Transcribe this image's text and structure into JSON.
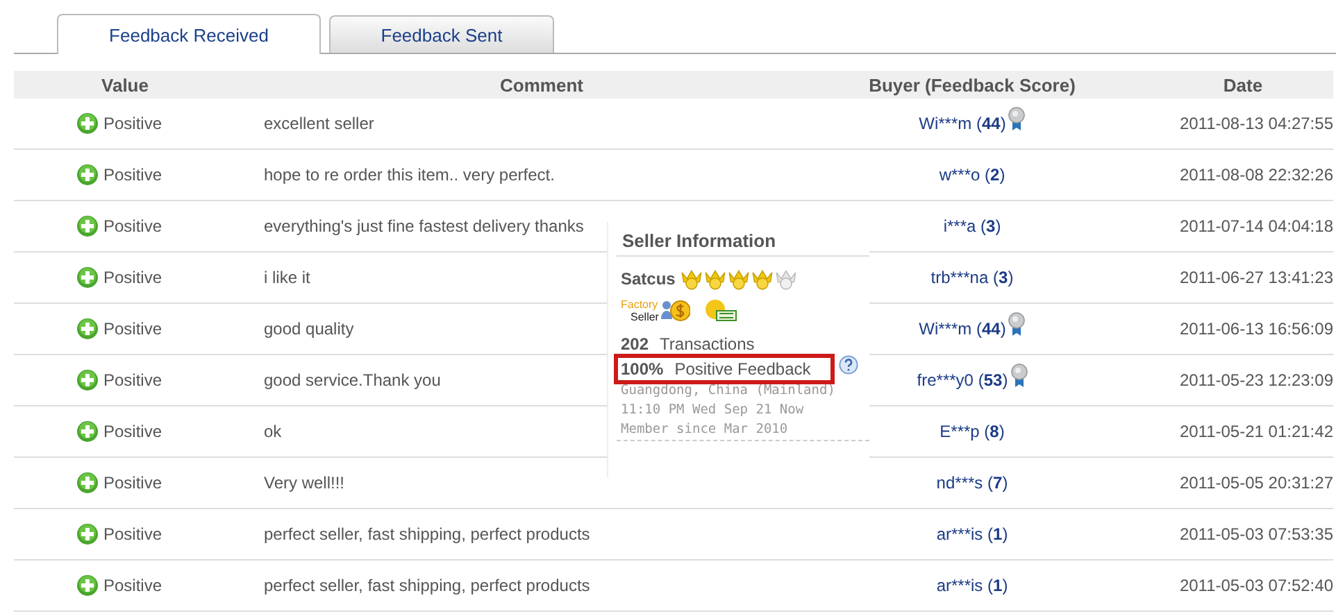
{
  "tabs": [
    {
      "label": "Feedback Received",
      "selected": true
    },
    {
      "label": "Feedback Sent",
      "selected": false
    }
  ],
  "table": {
    "columns": [
      "Value",
      "Comment",
      "Buyer (Feedback Score)",
      "Date"
    ],
    "rows": [
      {
        "value": "Positive",
        "comment": "excellent seller",
        "buyer": "Wi***m",
        "score": "(**44**)",
        "medal": true,
        "date": "2011-08-13 04:27:55"
      },
      {
        "value": "Positive",
        "comment": "hope to re order this item.. very perfect.",
        "buyer": "w***o",
        "score": "(**2**)",
        "medal": false,
        "date": "2011-08-08 22:32:26"
      },
      {
        "value": "Positive",
        "comment": "everything's just fine fastest delivery thanks",
        "buyer": "i***a",
        "score": "(**3**)",
        "medal": false,
        "date": "2011-07-14 04:04:18"
      },
      {
        "value": "Positive",
        "comment": "i like it",
        "buyer": "trb***na",
        "score": "(**3**)",
        "medal": false,
        "date": "2011-06-27 13:41:23"
      },
      {
        "value": "Positive",
        "comment": "good quality",
        "buyer": "Wi***m",
        "score": "(**44**)",
        "medal": true,
        "date": "2011-06-13 16:56:09"
      },
      {
        "value": "Positive",
        "comment": "good service.Thank you",
        "buyer": "fre***y0",
        "score": "(**53**)",
        "medal": true,
        "date": "2011-05-23 12:23:09"
      },
      {
        "value": "Positive",
        "comment": "ok",
        "buyer": "E***p",
        "score": "(**8**)",
        "medal": false,
        "date": "2011-05-21 01:21:42"
      },
      {
        "value": "Positive",
        "comment": "Very well!!!",
        "buyer": "nd***s",
        "score": "(**7**)",
        "medal": false,
        "date": "2011-05-05 20:31:27"
      },
      {
        "value": "Positive",
        "comment": "perfect seller, fast shipping, perfect products",
        "buyer": "ar***is",
        "score": "(**1**)",
        "medal": false,
        "date": "2011-05-03 07:53:35"
      },
      {
        "value": "Positive",
        "comment": "perfect seller, fast shipping, perfect products",
        "buyer": "ar***is",
        "score": "(**1**)",
        "medal": false,
        "date": "2011-05-03 07:52:40"
      }
    ]
  },
  "seller_popup": {
    "title": "Seller Information",
    "name": "Satcus",
    "stars": 4,
    "factory_badge": {
      "line1": "Factory",
      "line2": "Seller"
    },
    "transactions_count": "202",
    "transactions_label": "Transactions",
    "positive_percent": "100%",
    "positive_label": "Positive Feedback",
    "location": "Guangdong, China (Mainland)",
    "local_time": "11:10 PM Wed Sep 21 Now",
    "member_since": "Member since Mar 2010"
  }
}
